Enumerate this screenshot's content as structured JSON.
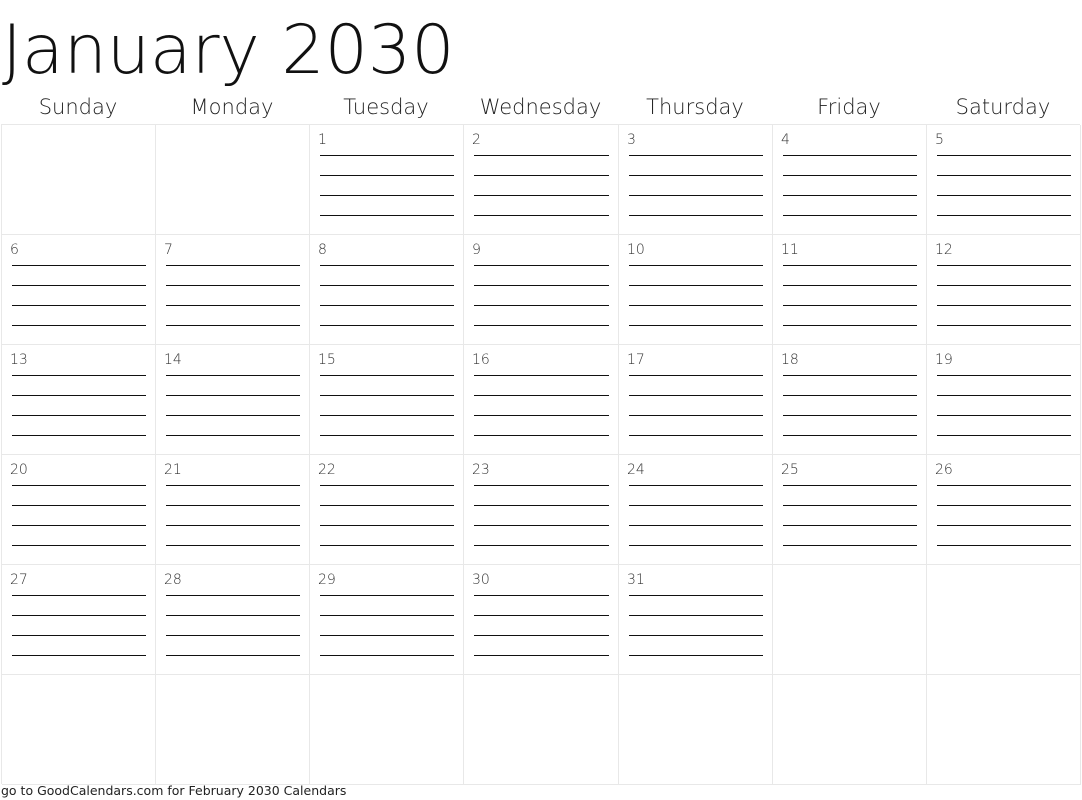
{
  "title": "January 2030",
  "weekdays": [
    "Sunday",
    "Monday",
    "Tuesday",
    "Wednesday",
    "Thursday",
    "Friday",
    "Saturday"
  ],
  "weeks": [
    [
      "",
      "",
      "1",
      "2",
      "3",
      "4",
      "5"
    ],
    [
      "6",
      "7",
      "8",
      "9",
      "10",
      "11",
      "12"
    ],
    [
      "13",
      "14",
      "15",
      "16",
      "17",
      "18",
      "19"
    ],
    [
      "20",
      "21",
      "22",
      "23",
      "24",
      "25",
      "26"
    ],
    [
      "27",
      "28",
      "29",
      "30",
      "31",
      "",
      ""
    ],
    [
      "",
      "",
      "",
      "",
      "",
      "",
      ""
    ]
  ],
  "lines_per_day": 4,
  "footer": "go to GoodCalendars.com for February 2030 Calendars"
}
